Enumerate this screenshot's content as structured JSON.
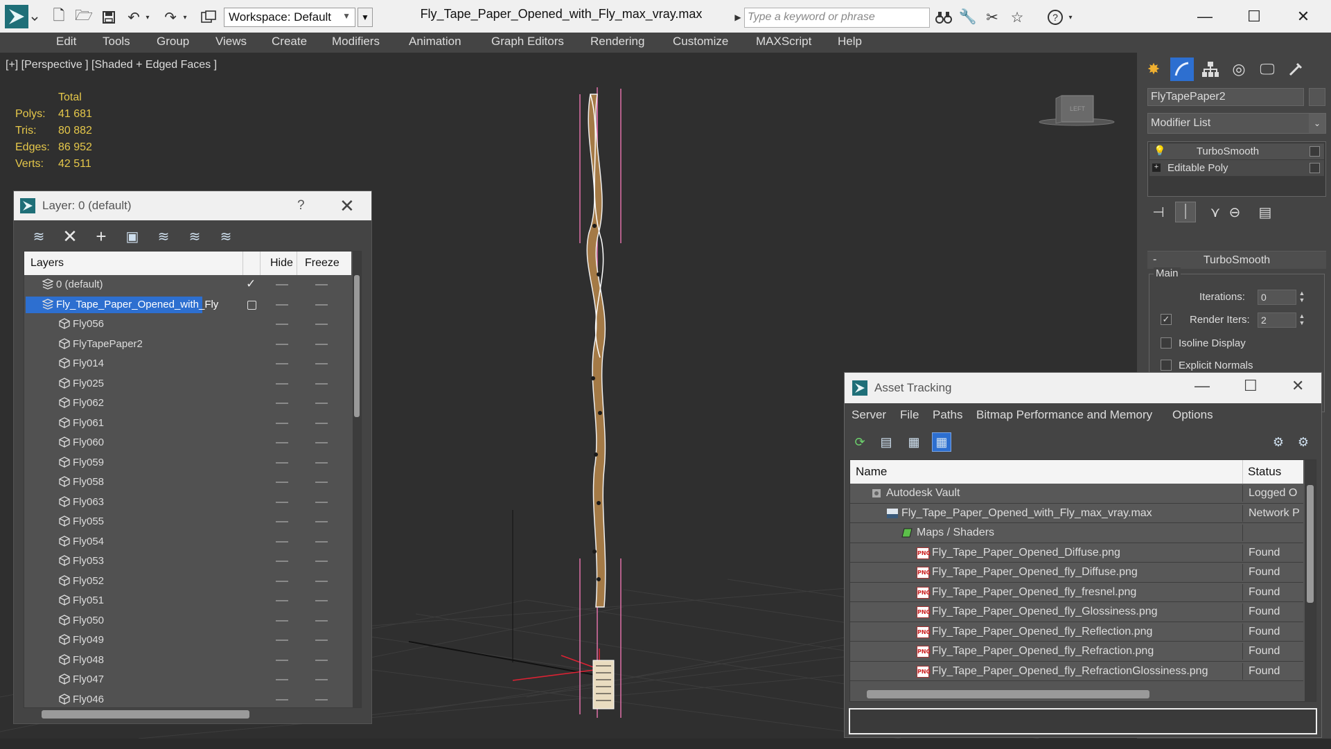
{
  "window": {
    "title": "Fly_Tape_Paper_Opened_with_Fly_max_vray.max",
    "workspace": "Workspace: Default",
    "search_placeholder": "Type a keyword or phrase",
    "minimize": "—",
    "maximize": "☐",
    "close": "✕"
  },
  "menu": [
    "Edit",
    "Tools",
    "Group",
    "Views",
    "Create",
    "Modifiers",
    "Animation",
    "Graph Editors",
    "Rendering",
    "Customize",
    "MAXScript",
    "Help"
  ],
  "viewport": {
    "label": "[+] [Perspective ] [Shaded + Edged Faces ]",
    "stats_header": "Total",
    "stats": [
      {
        "label": "Polys:",
        "value": "41 681"
      },
      {
        "label": "Tris:",
        "value": "80 882"
      },
      {
        "label": "Edges:",
        "value": "86 952"
      },
      {
        "label": "Verts:",
        "value": "42 511"
      }
    ],
    "viewcube_label": "LEFT"
  },
  "layer_dialog": {
    "title": "Layer: 0 (default)",
    "help": "?",
    "close": "✕",
    "columns": {
      "layers": "Layers",
      "hide": "Hide",
      "freeze": "Freeze"
    },
    "rows": [
      {
        "name": "0 (default)",
        "kind": "layer",
        "active": true
      },
      {
        "name": "Fly_Tape_Paper_Opened_with_Fly",
        "kind": "layer",
        "selected": true
      },
      {
        "name": "Fly056",
        "kind": "object"
      },
      {
        "name": "FlyTapePaper2",
        "kind": "object"
      },
      {
        "name": "Fly014",
        "kind": "object"
      },
      {
        "name": "Fly025",
        "kind": "object"
      },
      {
        "name": "Fly062",
        "kind": "object"
      },
      {
        "name": "Fly061",
        "kind": "object"
      },
      {
        "name": "Fly060",
        "kind": "object"
      },
      {
        "name": "Fly059",
        "kind": "object"
      },
      {
        "name": "Fly058",
        "kind": "object"
      },
      {
        "name": "Fly063",
        "kind": "object"
      },
      {
        "name": "Fly055",
        "kind": "object"
      },
      {
        "name": "Fly054",
        "kind": "object"
      },
      {
        "name": "Fly053",
        "kind": "object"
      },
      {
        "name": "Fly052",
        "kind": "object"
      },
      {
        "name": "Fly051",
        "kind": "object"
      },
      {
        "name": "Fly050",
        "kind": "object"
      },
      {
        "name": "Fly049",
        "kind": "object"
      },
      {
        "name": "Fly048",
        "kind": "object"
      },
      {
        "name": "Fly047",
        "kind": "object"
      },
      {
        "name": "Fly046",
        "kind": "object"
      }
    ]
  },
  "command_panel": {
    "object_name": "FlyTapePaper2",
    "modifier_list": "Modifier List",
    "stack": [
      "TurboSmooth",
      "Editable Poly"
    ],
    "rollout_toggle": "-",
    "rollout_title": "TurboSmooth",
    "main_group": "Main",
    "iterations_label": "Iterations:",
    "iterations_value": "0",
    "render_iters_label": "Render Iters:",
    "render_iters_value": "2",
    "render_iters_checked": "✓",
    "isoline_label": "Isoline Display",
    "explicit_normals_label": "Explicit Normals"
  },
  "asset_dialog": {
    "title": "Asset Tracking",
    "minimize": "—",
    "maximize": "☐",
    "close": "✕",
    "menu": [
      "Server",
      "File",
      "Paths",
      "Bitmap Performance and Memory",
      "Options"
    ],
    "columns": {
      "name": "Name",
      "status": "Status"
    },
    "rows": [
      {
        "name": "Autodesk Vault",
        "status": "Logged O",
        "icon": "vault",
        "indent": 1
      },
      {
        "name": "Fly_Tape_Paper_Opened_with_Fly_max_vray.max",
        "status": "Network P",
        "icon": "max",
        "indent": 2
      },
      {
        "name": "Maps / Shaders",
        "status": "",
        "icon": "maps",
        "indent": 3
      },
      {
        "name": "Fly_Tape_Paper_Opened_Diffuse.png",
        "status": "Found",
        "icon": "png",
        "indent": 4
      },
      {
        "name": "Fly_Tape_Paper_Opened_fly_Diffuse.png",
        "status": "Found",
        "icon": "png",
        "indent": 4
      },
      {
        "name": "Fly_Tape_Paper_Opened_fly_fresnel.png",
        "status": "Found",
        "icon": "png",
        "indent": 4
      },
      {
        "name": "Fly_Tape_Paper_Opened_fly_Glossiness.png",
        "status": "Found",
        "icon": "png",
        "indent": 4
      },
      {
        "name": "Fly_Tape_Paper_Opened_fly_Reflection.png",
        "status": "Found",
        "icon": "png",
        "indent": 4
      },
      {
        "name": "Fly_Tape_Paper_Opened_fly_Refraction.png",
        "status": "Found",
        "icon": "png",
        "indent": 4
      },
      {
        "name": "Fly_Tape_Paper_Opened_fly_RefractionGlossiness.png",
        "status": "Found",
        "icon": "png",
        "indent": 4
      }
    ],
    "png_badge": "PNG"
  },
  "colors": {
    "selection": "#2d6fd0",
    "stats_text": "#e6c84a",
    "viewport_bg": "#2f2f2f",
    "panel_bg": "#444444"
  }
}
